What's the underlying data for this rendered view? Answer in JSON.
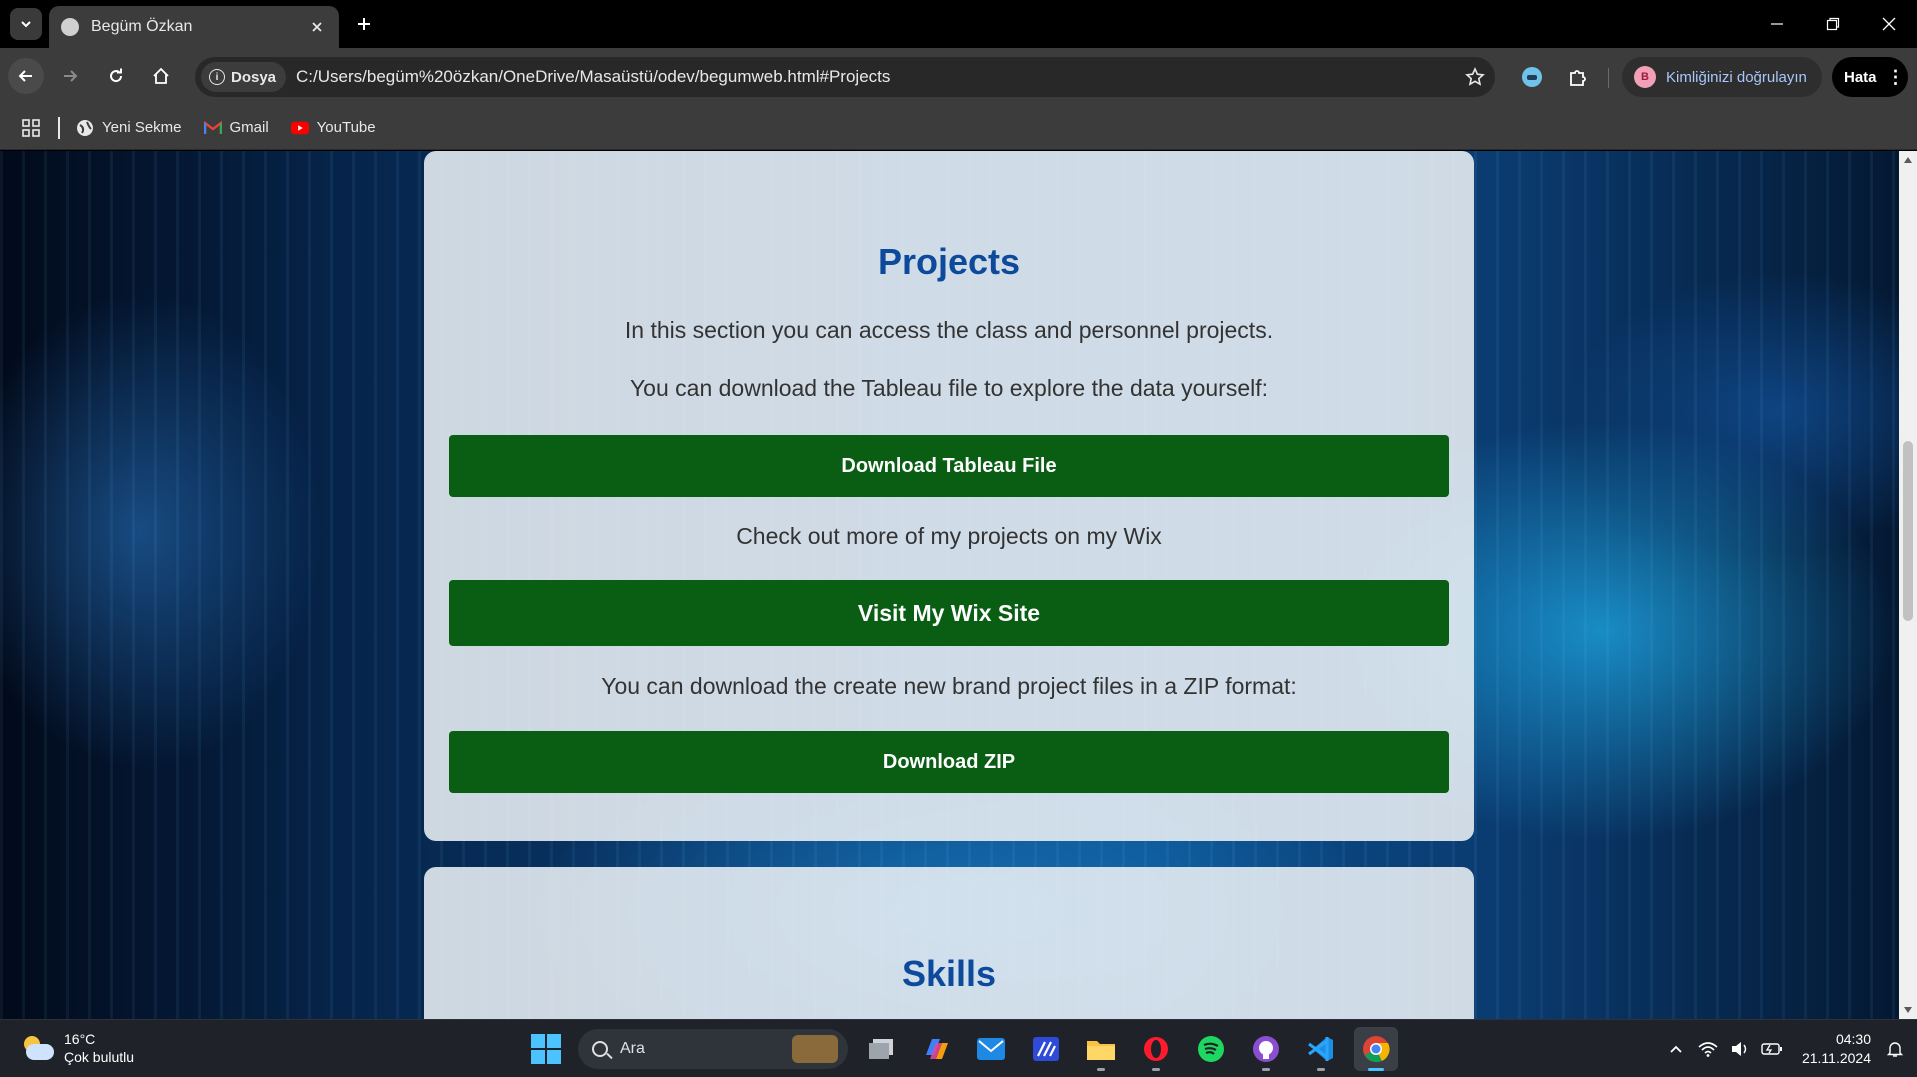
{
  "browser": {
    "tab_title": "Begüm Özkan",
    "security_chip": "Dosya",
    "url": "C:/Users/begüm%20özkan/OneDrive/Masaüstü/odev/begumweb.html#Projects",
    "profile_label": "Kimliğinizi doğrulayın",
    "profile_initial": "B",
    "error_label": "Hata",
    "bookmarks": [
      {
        "label": "Yeni Sekme",
        "icon": "globe-icon"
      },
      {
        "label": "Gmail",
        "icon": "gmail-icon"
      },
      {
        "label": "YouTube",
        "icon": "youtube-icon"
      }
    ]
  },
  "page": {
    "projects": {
      "heading": "Projects",
      "intro": "In this section you can access the class and personnel projects.",
      "tableau_text": "You can download the Tableau file to explore the data yourself:",
      "tableau_button": "Download Tableau File",
      "wix_text": "Check out more of my projects on my Wix",
      "wix_button": "Visit My Wix Site",
      "zip_text": "You can download the create new brand project files in a ZIP format:",
      "zip_button": "Download ZIP"
    },
    "skills": {
      "heading": "Skills"
    }
  },
  "taskbar": {
    "weather_temp": "16°C",
    "weather_desc": "Çok bulutlu",
    "search_placeholder": "Ara",
    "time": "04:30",
    "date": "21.11.2024",
    "apps": [
      "task-view-icon",
      "copilot-icon",
      "mail-icon",
      "editor-icon",
      "file-explorer-icon",
      "opera-icon",
      "spotify-icon",
      "github-icon",
      "vscode-icon",
      "chrome-icon"
    ]
  },
  "colors": {
    "accent_heading": "#0d4a9b",
    "button_green": "#0a5e14"
  }
}
